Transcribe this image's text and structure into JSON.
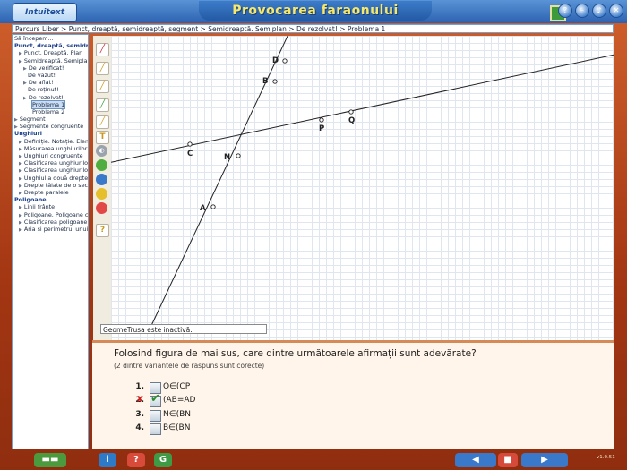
{
  "app": {
    "logo_text": "Intuitext",
    "title": "Provocarea faraonului",
    "version": "v1.0.51"
  },
  "breadcrumb": "Parcurs Liber > Punct, dreaptă, semidreaptă, segment > Semidreaptă. Semiplan > De rezolvat! > Problema 1",
  "tree": [
    {
      "label": "Să începem...",
      "kind": "plain",
      "indent": 0
    },
    {
      "label": "Punct, dreaptă, semidrea",
      "kind": "cat",
      "indent": 0
    },
    {
      "label": "Punct. Dreaptă. Plan",
      "kind": "node",
      "indent": 1
    },
    {
      "label": "Semidreaptă. Semiplan",
      "kind": "node",
      "indent": 1
    },
    {
      "label": "De verificat!",
      "kind": "node",
      "indent": 2
    },
    {
      "label": "De văzut!",
      "kind": "plain",
      "indent": 3
    },
    {
      "label": "De aflat!",
      "kind": "node",
      "indent": 2
    },
    {
      "label": "De reținut!",
      "kind": "plain",
      "indent": 3
    },
    {
      "label": "De rezolvat!",
      "kind": "node",
      "indent": 2
    },
    {
      "label": "Problema 1",
      "kind": "sel",
      "indent": 4
    },
    {
      "label": "Problema 2",
      "kind": "plain",
      "indent": 4
    },
    {
      "label": "Segment",
      "kind": "node",
      "indent": 0
    },
    {
      "label": "Segmente congruente",
      "kind": "node",
      "indent": 0
    },
    {
      "label": "Unghiuri",
      "kind": "cat",
      "indent": 0
    },
    {
      "label": "Definiție. Notație. Eleme",
      "kind": "node",
      "indent": 1
    },
    {
      "label": "Măsurarea unghiurilor",
      "kind": "node",
      "indent": 1
    },
    {
      "label": "Unghiuri congruente",
      "kind": "node",
      "indent": 1
    },
    {
      "label": "Clasificarea unghiurilor",
      "kind": "node",
      "indent": 1
    },
    {
      "label": "Clasificarea unghiurilor",
      "kind": "node",
      "indent": 1
    },
    {
      "label": "Unghiul a două drepte.",
      "kind": "node",
      "indent": 1
    },
    {
      "label": "Drepte tăiate de o seca",
      "kind": "node",
      "indent": 1
    },
    {
      "label": "Drepte paralele",
      "kind": "node",
      "indent": 1
    },
    {
      "label": "Poligoane",
      "kind": "cat",
      "indent": 0
    },
    {
      "label": "Linii frânte",
      "kind": "node",
      "indent": 1
    },
    {
      "label": "Poligoane. Poligoane co",
      "kind": "node",
      "indent": 1
    },
    {
      "label": "Clasificarea poligoanelo",
      "kind": "node",
      "indent": 1
    },
    {
      "label": "Aria și perimetrul unui p",
      "kind": "node",
      "indent": 1
    }
  ],
  "figure": {
    "points": [
      "D",
      "B",
      "P",
      "Q",
      "C",
      "N",
      "A"
    ]
  },
  "status_text": "GeomeTrusa este inactivă.",
  "question": {
    "title": "Folosind figura de mai sus, care dintre următoarele afirmații sunt adevărate?",
    "subtitle": "(2 dintre variantele de răspuns sunt corecte)",
    "answers": [
      {
        "num": "1.",
        "text": "Q∈(CP",
        "checked": false,
        "wrong_mark": false
      },
      {
        "num": "2.",
        "text": "(AB=AD",
        "checked": true,
        "wrong_mark": true
      },
      {
        "num": "3.",
        "text": "N∈(BN",
        "checked": false,
        "wrong_mark": false
      },
      {
        "num": "4.",
        "text": "B∈(BN",
        "checked": false,
        "wrong_mark": false
      }
    ]
  },
  "colors": {
    "accent": "#2c62b0",
    "frame": "#b8411d",
    "grid": "#dfe6ee",
    "check": "#2a8f2a",
    "wrong": "#d11d1d"
  }
}
